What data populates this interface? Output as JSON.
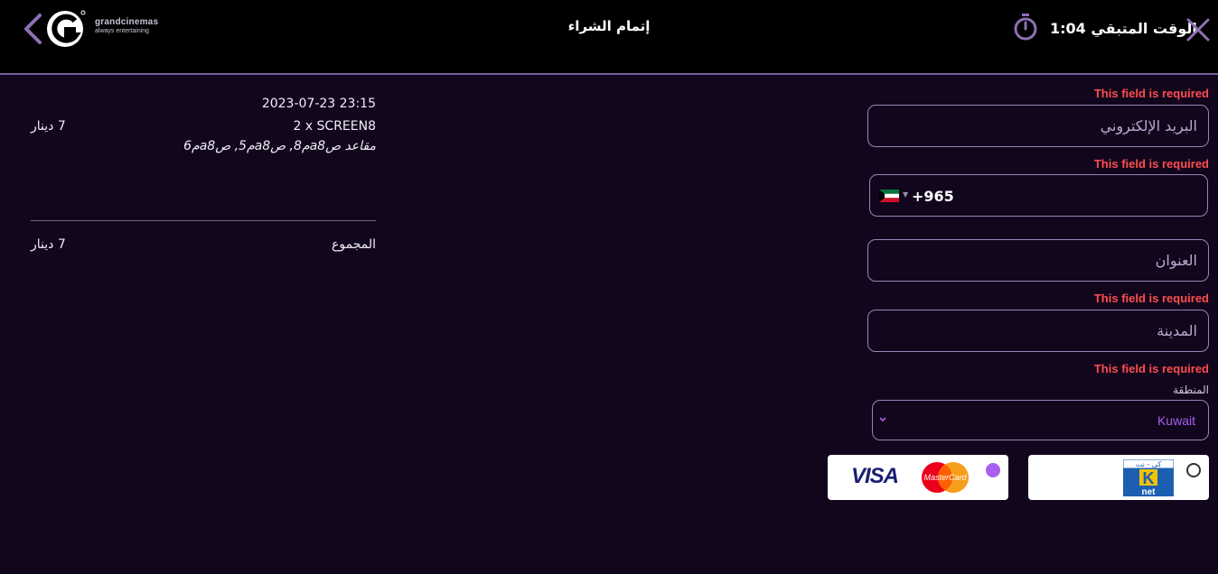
{
  "header": {
    "title": "إتمام الشراء",
    "timer_label": "الوقت المتبقي",
    "timer_value": "1:04",
    "logo_brand": "grandcinemas",
    "logo_tagline": "always entertaining"
  },
  "summary": {
    "datetime": "2023-07-23 23:15",
    "tickets": "2 x SCREEN8",
    "seats": "مقاعد صa8م8, صa8م5, صa8م6",
    "line_price": "7 دينار",
    "total_label": "المجموع",
    "total_price": "7 دينار"
  },
  "form": {
    "required_error": "This field is required",
    "email_placeholder": "البريد الإلكتروني",
    "phone_dial_code": "+965",
    "address_placeholder": "العنوان",
    "city_placeholder": "المدينة",
    "region_label": "المنطقة",
    "region_value": "Kuwait"
  },
  "payment": {
    "options": [
      {
        "name": "KNET",
        "selected": false
      },
      {
        "name": "VISA / MasterCard",
        "selected": true
      }
    ],
    "visa_text": "VISA",
    "mastercard_text": "MasterCard",
    "knet_top_text": "كي - نت",
    "knet_bottom_text": "net"
  },
  "colors": {
    "background": "#12061d",
    "accent": "#a95ff0",
    "error": "#ff4d4d",
    "border": "#9a83b6"
  }
}
